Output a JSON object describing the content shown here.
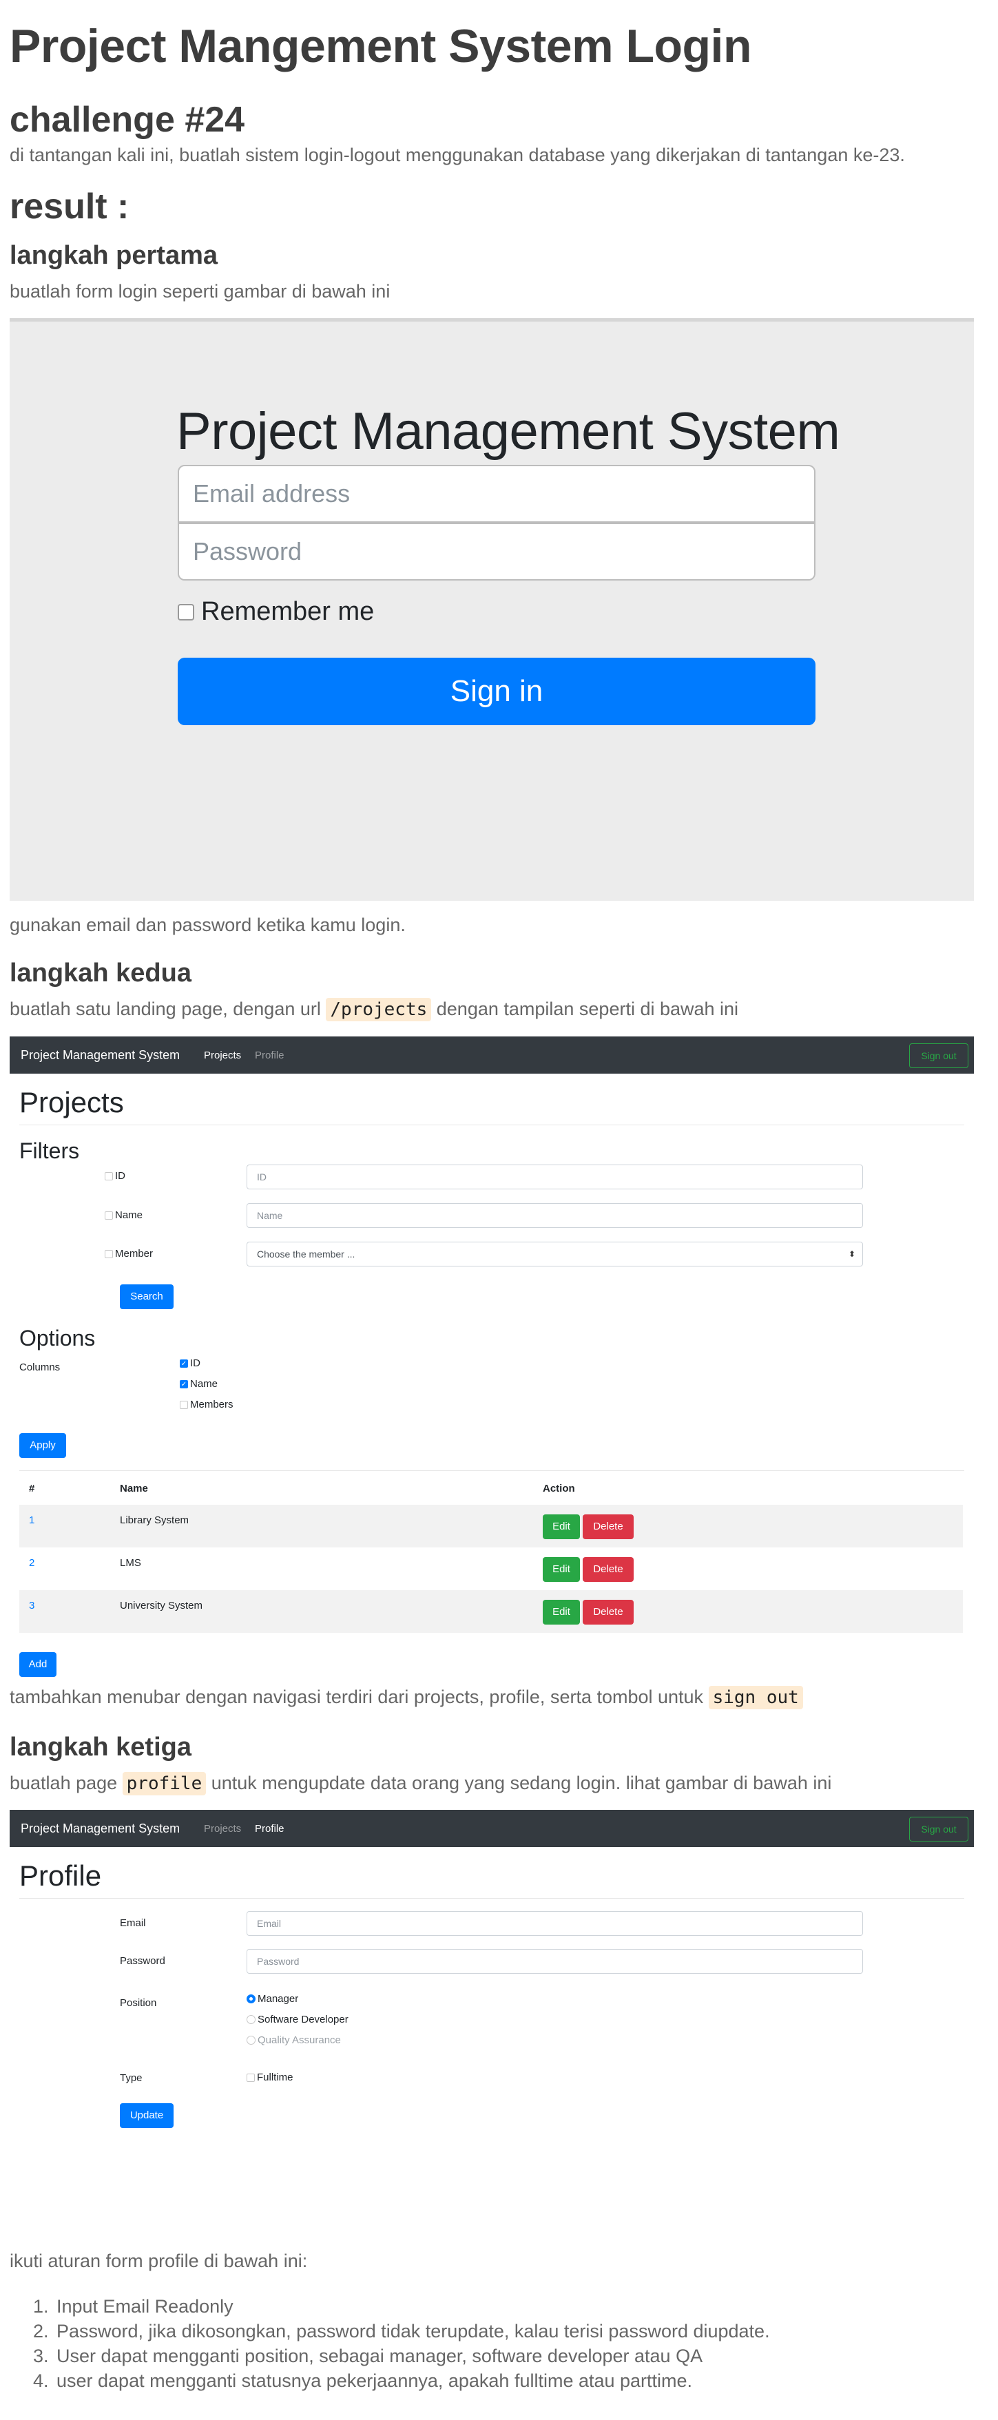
{
  "doc": {
    "title": "Project Mangement System Login",
    "challenge_heading": "challenge #24",
    "challenge_desc": "di tantangan kali ini, buatlah sistem login-logout menggunakan database yang dikerjakan di tantangan ke-23.",
    "result_heading": "result :",
    "step1_heading": "langkah pertama",
    "step1_desc": "buatlah form login seperti gambar di bawah ini",
    "step1_after": "gunakan email dan password ketika kamu login.",
    "step2_heading": "langkah kedua",
    "step2_desc_before": "buatlah satu landing page, dengan url ",
    "step2_code": "/projects",
    "step2_desc_after": " dengan tampilan seperti di bawah ini",
    "step2_after_before": "tambahkan menubar dengan navigasi terdiri dari projects, profile, serta tombol untuk ",
    "step2_after_code": "sign out",
    "step3_heading": "langkah ketiga",
    "step3_desc_before": "buatlah page ",
    "step3_code": "profile",
    "step3_desc_after": " untuk mengupdate data orang yang sedang login. lihat gambar di bawah ini",
    "rules_intro": "ikuti aturan form profile di bawah ini:",
    "rules": [
      "Input Email Readonly",
      "Password, jika dikosongkan, password tidak terupdate, kalau terisi password diupdate.",
      "User dapat mengganti position, sebagai manager, software developer atau QA",
      "user dapat mengganti statusnya pekerjaannya, apakah fulltime atau parttime."
    ]
  },
  "login": {
    "title": "Project Management System",
    "email_placeholder": "Email address",
    "password_placeholder": "Password",
    "remember_label": "Remember me",
    "signin_label": "Sign in"
  },
  "navbar": {
    "brand": "Project Management System",
    "projects": "Projects",
    "profile": "Profile",
    "signout": "Sign out"
  },
  "projects_page": {
    "title": "Projects",
    "filters_title": "Filters",
    "filter_id_label": "ID",
    "filter_id_placeholder": "ID",
    "filter_name_label": "Name",
    "filter_name_placeholder": "Name",
    "filter_member_label": "Member",
    "filter_member_value": "Choose the member ...",
    "search_label": "Search",
    "options_title": "Options",
    "columns_label": "Columns",
    "col_id": "ID",
    "col_name": "Name",
    "col_members": "Members",
    "apply_label": "Apply",
    "table_headers": [
      "#",
      "Name",
      "Action"
    ],
    "rows": [
      {
        "id": "1",
        "name": "Library System"
      },
      {
        "id": "2",
        "name": "LMS"
      },
      {
        "id": "3",
        "name": "University System"
      }
    ],
    "edit_label": "Edit",
    "delete_label": "Delete",
    "add_label": "Add"
  },
  "profile_page": {
    "title": "Profile",
    "email_label": "Email",
    "email_placeholder": "Email",
    "password_label": "Password",
    "password_placeholder": "Password",
    "position_label": "Position",
    "position_options": [
      "Manager",
      "Software Developer",
      "Quality Assurance"
    ],
    "type_label": "Type",
    "type_option": "Fulltime",
    "update_label": "Update"
  }
}
